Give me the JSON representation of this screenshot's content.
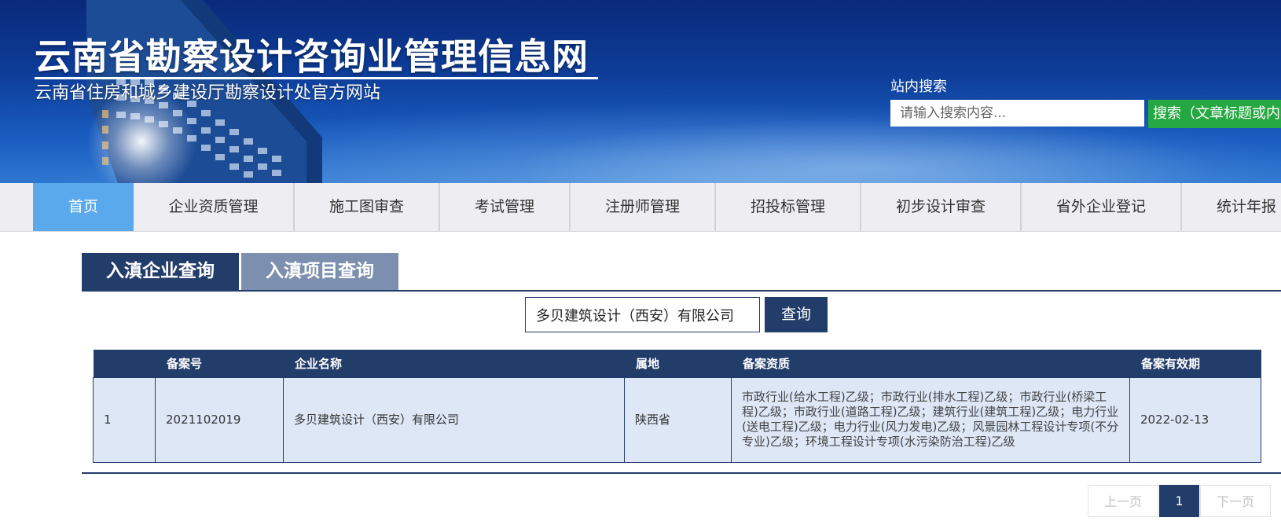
{
  "header": {
    "title": "云南省勘察设计咨询业管理信息网",
    "subtitle": "云南省住房和城乡建设厅勘察设计处官方网站",
    "search_label": "站内搜索",
    "search_placeholder": "请输入搜索内容...",
    "search_button": "搜索（文章标题或内容）"
  },
  "nav": {
    "items": [
      {
        "label": "首页",
        "active": true
      },
      {
        "label": "企业资质管理"
      },
      {
        "label": "施工图审查"
      },
      {
        "label": "考试管理"
      },
      {
        "label": "注册师管理"
      },
      {
        "label": "招投标管理"
      },
      {
        "label": "初步设计审查"
      },
      {
        "label": "省外企业登记"
      },
      {
        "label": "统计年报"
      }
    ]
  },
  "tabs": [
    {
      "label": "入滇企业查询",
      "active": true
    },
    {
      "label": "入滇项目查询",
      "active": false
    }
  ],
  "query": {
    "value": "多贝建筑设计（西安）有限公司",
    "button": "查询"
  },
  "table": {
    "headers": [
      "",
      "备案号",
      "企业名称",
      "属地",
      "备案资质",
      "备案有效期"
    ],
    "rows": [
      {
        "index": "1",
        "record_no": "2021102019",
        "company": "多贝建筑设计（西安）有限公司",
        "region": "陕西省",
        "qualifications": "市政行业(给水工程)乙级；市政行业(排水工程)乙级；市政行业(桥梁工程)乙级；市政行业(道路工程)乙级；建筑行业(建筑工程)乙级；电力行业(送电工程)乙级；电力行业(风力发电)乙级；风景园林工程设计专项(不分专业)乙级；环境工程设计专项(水污染防治工程)乙级",
        "valid_until": "2022-02-13"
      }
    ]
  },
  "pager": {
    "prev": "上一页",
    "current": "1",
    "next": "下一页"
  },
  "colors": {
    "primary_navy": "#233d6b",
    "nav_active": "#5aa9ec",
    "search_green": "#25a842",
    "row_bg": "#dde7f6"
  }
}
